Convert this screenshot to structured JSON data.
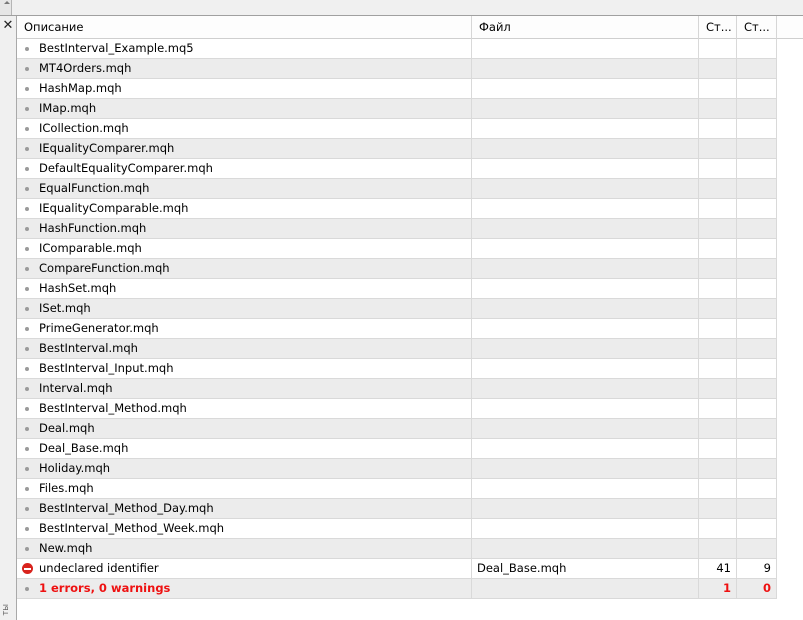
{
  "columns": {
    "description": "Описание",
    "file": "Файл",
    "line": "Ст...",
    "column": "Ст..."
  },
  "side_caption": "ты",
  "rows": [
    {
      "description": "BestInterval_Example.mq5",
      "file": "",
      "line": "",
      "column": ""
    },
    {
      "description": "MT4Orders.mqh",
      "file": "",
      "line": "",
      "column": ""
    },
    {
      "description": "HashMap.mqh",
      "file": "",
      "line": "",
      "column": ""
    },
    {
      "description": "IMap.mqh",
      "file": "",
      "line": "",
      "column": ""
    },
    {
      "description": "ICollection.mqh",
      "file": "",
      "line": "",
      "column": ""
    },
    {
      "description": "IEqualityComparer.mqh",
      "file": "",
      "line": "",
      "column": ""
    },
    {
      "description": "DefaultEqualityComparer.mqh",
      "file": "",
      "line": "",
      "column": ""
    },
    {
      "description": "EqualFunction.mqh",
      "file": "",
      "line": "",
      "column": ""
    },
    {
      "description": "IEqualityComparable.mqh",
      "file": "",
      "line": "",
      "column": ""
    },
    {
      "description": "HashFunction.mqh",
      "file": "",
      "line": "",
      "column": ""
    },
    {
      "description": "IComparable.mqh",
      "file": "",
      "line": "",
      "column": ""
    },
    {
      "description": "CompareFunction.mqh",
      "file": "",
      "line": "",
      "column": ""
    },
    {
      "description": "HashSet.mqh",
      "file": "",
      "line": "",
      "column": ""
    },
    {
      "description": "ISet.mqh",
      "file": "",
      "line": "",
      "column": ""
    },
    {
      "description": "PrimeGenerator.mqh",
      "file": "",
      "line": "",
      "column": ""
    },
    {
      "description": "BestInterval.mqh",
      "file": "",
      "line": "",
      "column": ""
    },
    {
      "description": "BestInterval_Input.mqh",
      "file": "",
      "line": "",
      "column": ""
    },
    {
      "description": "Interval.mqh",
      "file": "",
      "line": "",
      "column": ""
    },
    {
      "description": "BestInterval_Method.mqh",
      "file": "",
      "line": "",
      "column": ""
    },
    {
      "description": "Deal.mqh",
      "file": "",
      "line": "",
      "column": ""
    },
    {
      "description": "Deal_Base.mqh",
      "file": "",
      "line": "",
      "column": ""
    },
    {
      "description": "Holiday.mqh",
      "file": "",
      "line": "",
      "column": ""
    },
    {
      "description": "Files.mqh",
      "file": "",
      "line": "",
      "column": ""
    },
    {
      "description": "BestInterval_Method_Day.mqh",
      "file": "",
      "line": "",
      "column": ""
    },
    {
      "description": "BestInterval_Method_Week.mqh",
      "file": "",
      "line": "",
      "column": ""
    },
    {
      "description": "New.mqh",
      "file": "",
      "line": "",
      "column": ""
    }
  ],
  "error_row": {
    "description": "undeclared identifier",
    "file": "Deal_Base.mqh",
    "line": "41",
    "column": "9",
    "icon": "error-icon"
  },
  "summary_row": {
    "description": "1 errors, 0 warnings",
    "file": "",
    "line": "1",
    "column": "0",
    "color": "#ee1111"
  }
}
